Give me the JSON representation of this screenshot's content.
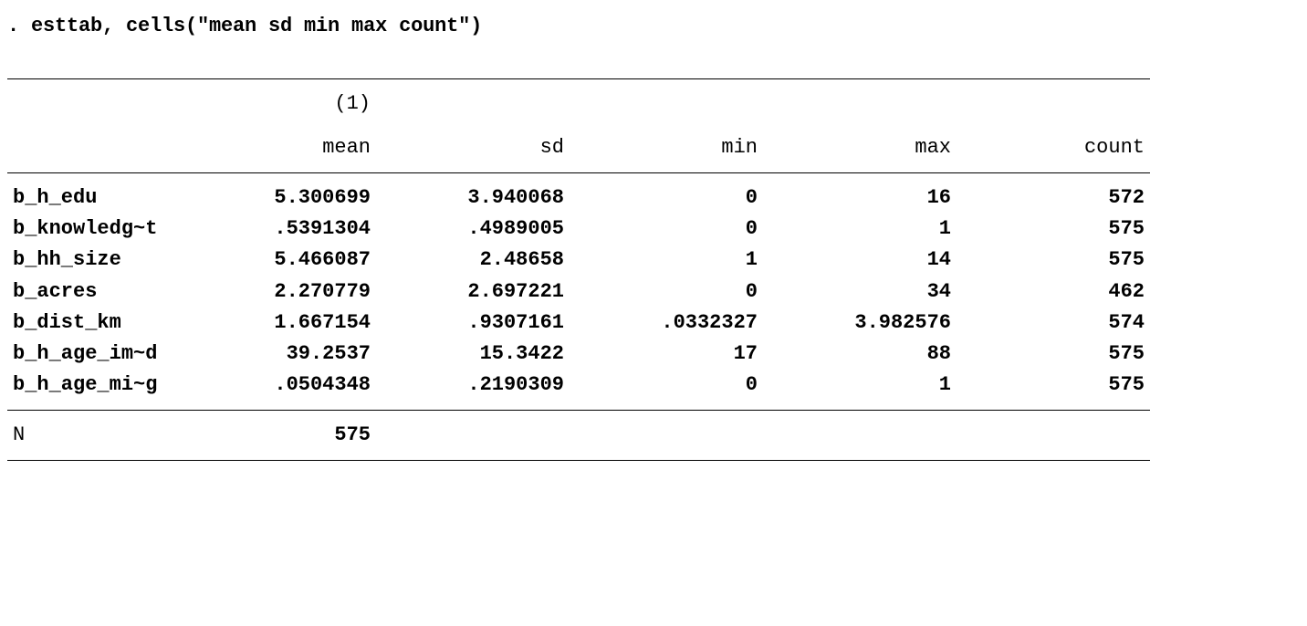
{
  "command": ". esttab, cells(\"mean sd min max count\")",
  "model_label": "(1)",
  "headers": {
    "mean": "mean",
    "sd": "sd",
    "min": "min",
    "max": "max",
    "count": "count"
  },
  "rows": [
    {
      "name": "b_h_edu",
      "mean": "5.300699",
      "sd": "3.940068",
      "min": "0",
      "max": "16",
      "count": "572"
    },
    {
      "name": "b_knowledg~t",
      "mean": ".5391304",
      "sd": ".4989005",
      "min": "0",
      "max": "1",
      "count": "575"
    },
    {
      "name": "b_hh_size",
      "mean": "5.466087",
      "sd": "2.48658",
      "min": "1",
      "max": "14",
      "count": "575"
    },
    {
      "name": "b_acres",
      "mean": "2.270779",
      "sd": "2.697221",
      "min": "0",
      "max": "34",
      "count": "462"
    },
    {
      "name": "b_dist_km",
      "mean": "1.667154",
      "sd": ".9307161",
      "min": ".0332327",
      "max": "3.982576",
      "count": "574"
    },
    {
      "name": "b_h_age_im~d",
      "mean": "39.2537",
      "sd": "15.3422",
      "min": "17",
      "max": "88",
      "count": "575"
    },
    {
      "name": "b_h_age_mi~g",
      "mean": ".0504348",
      "sd": ".2190309",
      "min": "0",
      "max": "1",
      "count": "575"
    }
  ],
  "footer": {
    "n_label": "N",
    "n_value": "575"
  }
}
